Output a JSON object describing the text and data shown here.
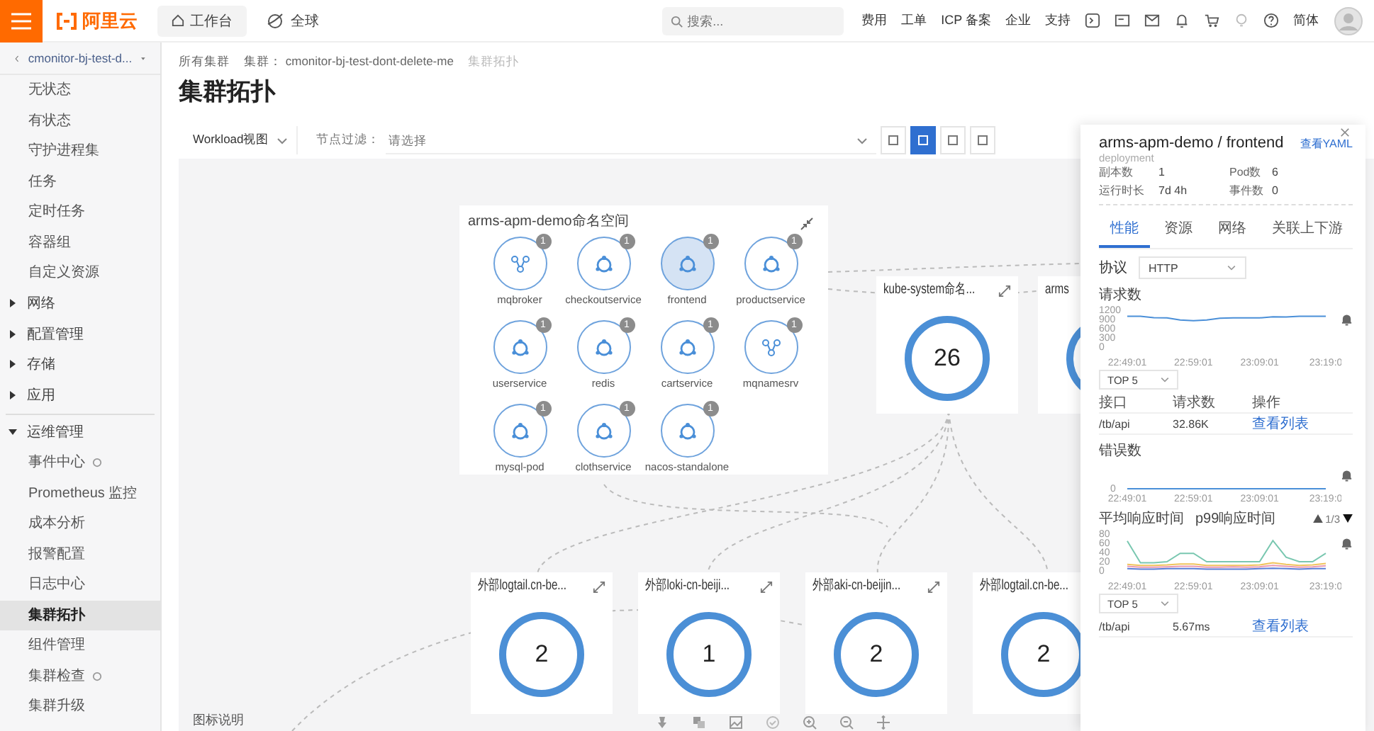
{
  "top_bar": {
    "logo": "阿里云",
    "workbench": "工作台",
    "region": "全球",
    "search": {
      "placeholder": "搜索..."
    },
    "links": [
      "费用",
      "工单",
      "ICP 备案",
      "企业",
      "支持"
    ],
    "language": "简体"
  },
  "sidebar": {
    "cluster": "cmonitor-bj-test-d...",
    "items": [
      {
        "label": "无状态",
        "kind": "item",
        "selected": false
      },
      {
        "label": "有状态",
        "kind": "item",
        "selected": false
      },
      {
        "label": "守护进程集",
        "kind": "item",
        "selected": false
      },
      {
        "label": "任务",
        "kind": "item",
        "selected": false
      },
      {
        "label": "定时任务",
        "kind": "item",
        "selected": false
      },
      {
        "label": "容器组",
        "kind": "item",
        "selected": false
      },
      {
        "label": "自定义资源",
        "kind": "item",
        "selected": false
      },
      {
        "label": "网络",
        "kind": "group",
        "expanded": false
      },
      {
        "label": "配置管理",
        "kind": "group",
        "expanded": false
      },
      {
        "label": "存储",
        "kind": "group",
        "expanded": false
      },
      {
        "label": "应用",
        "kind": "group",
        "expanded": false
      },
      {
        "label": "运维管理",
        "kind": "group",
        "expanded": true,
        "children": [
          {
            "label": "事件中心",
            "selected": false,
            "has_icon": true
          },
          {
            "label": "Prometheus 监控",
            "selected": false,
            "has_icon": false
          },
          {
            "label": "成本分析",
            "selected": false,
            "has_icon": false
          },
          {
            "label": "报警配置",
            "selected": false,
            "has_icon": false
          },
          {
            "label": "日志中心",
            "selected": false,
            "has_icon": false
          },
          {
            "label": "集群拓扑",
            "selected": true,
            "has_icon": false
          },
          {
            "label": "组件管理",
            "selected": false,
            "has_icon": false
          },
          {
            "label": "集群检查",
            "selected": false,
            "has_icon": true
          },
          {
            "label": "集群升级",
            "selected": false,
            "has_icon": false
          }
        ]
      }
    ]
  },
  "breadcrumb": [
    "所有集群",
    "集群： cmonitor-bj-test-dont-delete-me",
    "集群拓扑"
  ],
  "title": "集群拓扑",
  "toolbar": {
    "view": "Workload视图",
    "filter_label": "节点过滤：",
    "filter": {
      "placeholder": "请选择"
    },
    "view_buttons": [
      {
        "selected": false
      },
      {
        "selected": true
      },
      {
        "selected": false
      },
      {
        "selected": false
      }
    ]
  },
  "canvas": {
    "namespace": {
      "title": "arms-apm-demo命名空间",
      "workloads": [
        {
          "name": "mqbroker",
          "badge": "1",
          "kind": "group",
          "selected": false
        },
        {
          "name": "checkoutservice",
          "badge": "1",
          "kind": "app",
          "selected": false
        },
        {
          "name": "frontend",
          "badge": "1",
          "kind": "app",
          "selected": true
        },
        {
          "name": "productservice",
          "badge": "1",
          "kind": "app",
          "selected": false
        },
        {
          "name": "userservice",
          "badge": "1",
          "kind": "app",
          "selected": false
        },
        {
          "name": "redis",
          "badge": "1",
          "kind": "app",
          "selected": false
        },
        {
          "name": "cartservice",
          "badge": "1",
          "kind": "app",
          "selected": false
        },
        {
          "name": "mqnamesrv",
          "badge": "1",
          "kind": "group",
          "selected": false
        },
        {
          "name": "mysql-pod",
          "badge": "1",
          "kind": "app",
          "selected": false
        },
        {
          "name": "clothservice",
          "badge": "1",
          "kind": "app",
          "selected": false
        },
        {
          "name": "nacos-standalone",
          "badge": "1",
          "kind": "app",
          "selected": false
        }
      ]
    },
    "groups": [
      {
        "title": "kube-system命名...",
        "count": "26"
      },
      {
        "title": "arms"
      }
    ],
    "external": [
      {
        "title": "外部logtail.cn-be...",
        "count": "2"
      },
      {
        "title": "外部loki-cn-beiji...",
        "count": "1"
      },
      {
        "title": "外部aki-cn-beijin...",
        "count": "2"
      },
      {
        "title": "外部logtail.cn-be...",
        "count": "2"
      }
    ],
    "legend": "图标说明"
  },
  "panel": {
    "title": "arms-apm-demo / frontend",
    "yaml_link": "查看YAML",
    "kind_label": "deployment",
    "stats": [
      {
        "label": "副本数",
        "value": "1"
      },
      {
        "label": "Pod数",
        "value": "6"
      },
      {
        "label": "运行时长",
        "value": "7d 4h"
      },
      {
        "label": "事件数",
        "value": "0"
      }
    ],
    "tabs": [
      {
        "label": "性能",
        "selected": true
      },
      {
        "label": "资源",
        "selected": false
      },
      {
        "label": "网络",
        "selected": false
      },
      {
        "label": "关联上下游",
        "selected": false
      }
    ],
    "protocol": {
      "label": "协议",
      "value": "HTTP"
    },
    "sections": [
      {
        "title": "请求数",
        "chart_data": {
          "type": "line",
          "categories": [
            "22:49:01",
            null,
            null,
            null,
            null,
            "22:59:01",
            null,
            null,
            null,
            null,
            "23:09:01",
            null,
            null,
            null,
            null,
            "23:19:0"
          ],
          "series": [
            {
              "color": "#4a8fd8",
              "values": [
                1000,
                1000,
                960,
                950,
                880,
                860,
                880,
                940,
                950,
                950,
                950,
                990,
                980,
                1000,
                1000,
                1000
              ]
            }
          ],
          "ylim": [
            0,
            1200
          ],
          "yticks": [
            0,
            300,
            600,
            900,
            1200
          ]
        },
        "top": "TOP 5",
        "table": {
          "columns": [
            "接口",
            "请求数",
            "操作"
          ],
          "rows": [
            [
              "/tb/api",
              "32.86K",
              "查看列表"
            ]
          ]
        }
      },
      {
        "title": "错误数",
        "zero_label": "0",
        "x_labels": [
          "22:49:01",
          "22:59:01",
          "23:09:01",
          "23:19:0"
        ]
      },
      {
        "legend": [
          "平均响应时间",
          "p99响应时间"
        ],
        "pager": "1/3",
        "chart_data": {
          "type": "line",
          "series": [
            {
              "color": "#79c7b0",
              "values": [
                65,
                18,
                18,
                20,
                38,
                38,
                20,
                20,
                20,
                20,
                20,
                66,
                30,
                20,
                20,
                38
              ]
            },
            {
              "color": "#f0c45c",
              "values": [
                14,
                12,
                12,
                13,
                15,
                15,
                12,
                12,
                12,
                12,
                13,
                18,
                14,
                12,
                13,
                16
              ]
            },
            {
              "color": "#e99ab2",
              "values": [
                10,
                8,
                8,
                9,
                10,
                10,
                8,
                8,
                9,
                8,
                9,
                12,
                10,
                8,
                9,
                11
              ]
            },
            {
              "color": "#5a7fd6",
              "values": [
                5,
                4,
                4,
                5,
                5,
                5,
                4,
                4,
                4,
                4,
                5,
                6,
                5,
                4,
                5,
                5
              ]
            }
          ],
          "categories": [
            "22:49:01",
            null,
            null,
            null,
            null,
            "22:59:01",
            null,
            null,
            null,
            null,
            "23:09:01",
            null,
            null,
            null,
            null,
            "23:19:0"
          ],
          "ylim": [
            0,
            80
          ],
          "yticks": [
            0,
            20,
            40,
            60,
            80
          ]
        },
        "top": "TOP 5",
        "table": {
          "rows": [
            [
              "/tb/api",
              "5.67ms",
              "查看列表"
            ]
          ]
        }
      }
    ]
  }
}
